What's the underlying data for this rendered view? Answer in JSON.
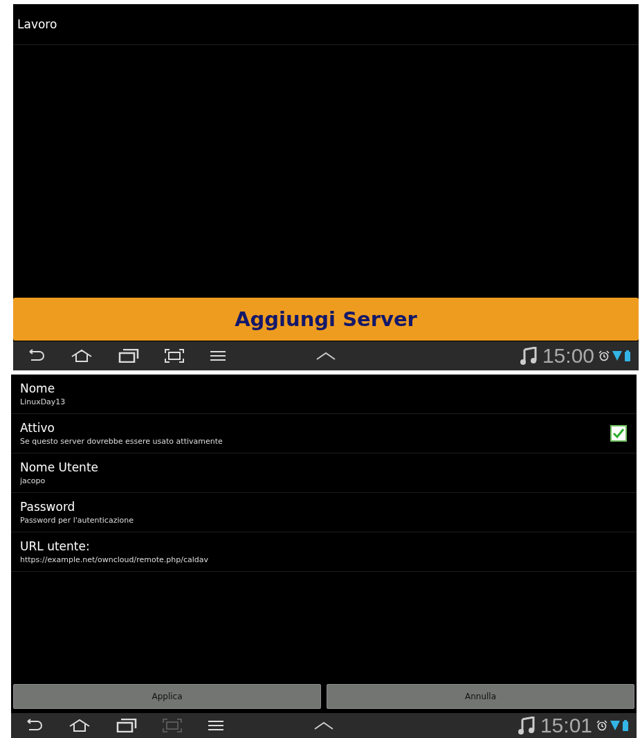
{
  "calendar_screen": {
    "title": "Lavoro",
    "add_button": "Aggiungi Server",
    "nav_bar": {
      "time": "15:00",
      "capture_enabled": true
    }
  },
  "server_screen": {
    "settings": [
      {
        "kind": "text",
        "label": "Nome",
        "summary": "LinuxDay13"
      },
      {
        "kind": "checkbox",
        "label": "Attivo",
        "summary": "Se questo server dovrebbe essere usato attivamente",
        "checked": true
      },
      {
        "kind": "text",
        "label": "Nome Utente",
        "summary": "jacopo"
      },
      {
        "kind": "text",
        "label": "Password",
        "summary": "Password per l'autenticazione"
      },
      {
        "kind": "text",
        "label": "URL utente:",
        "summary": "https://example.net/owncloud/remote.php/caldav"
      }
    ],
    "buttons": [
      "Applica",
      "Annulla"
    ],
    "nav_bar": {
      "time": "15:01",
      "capture_enabled": false
    }
  }
}
